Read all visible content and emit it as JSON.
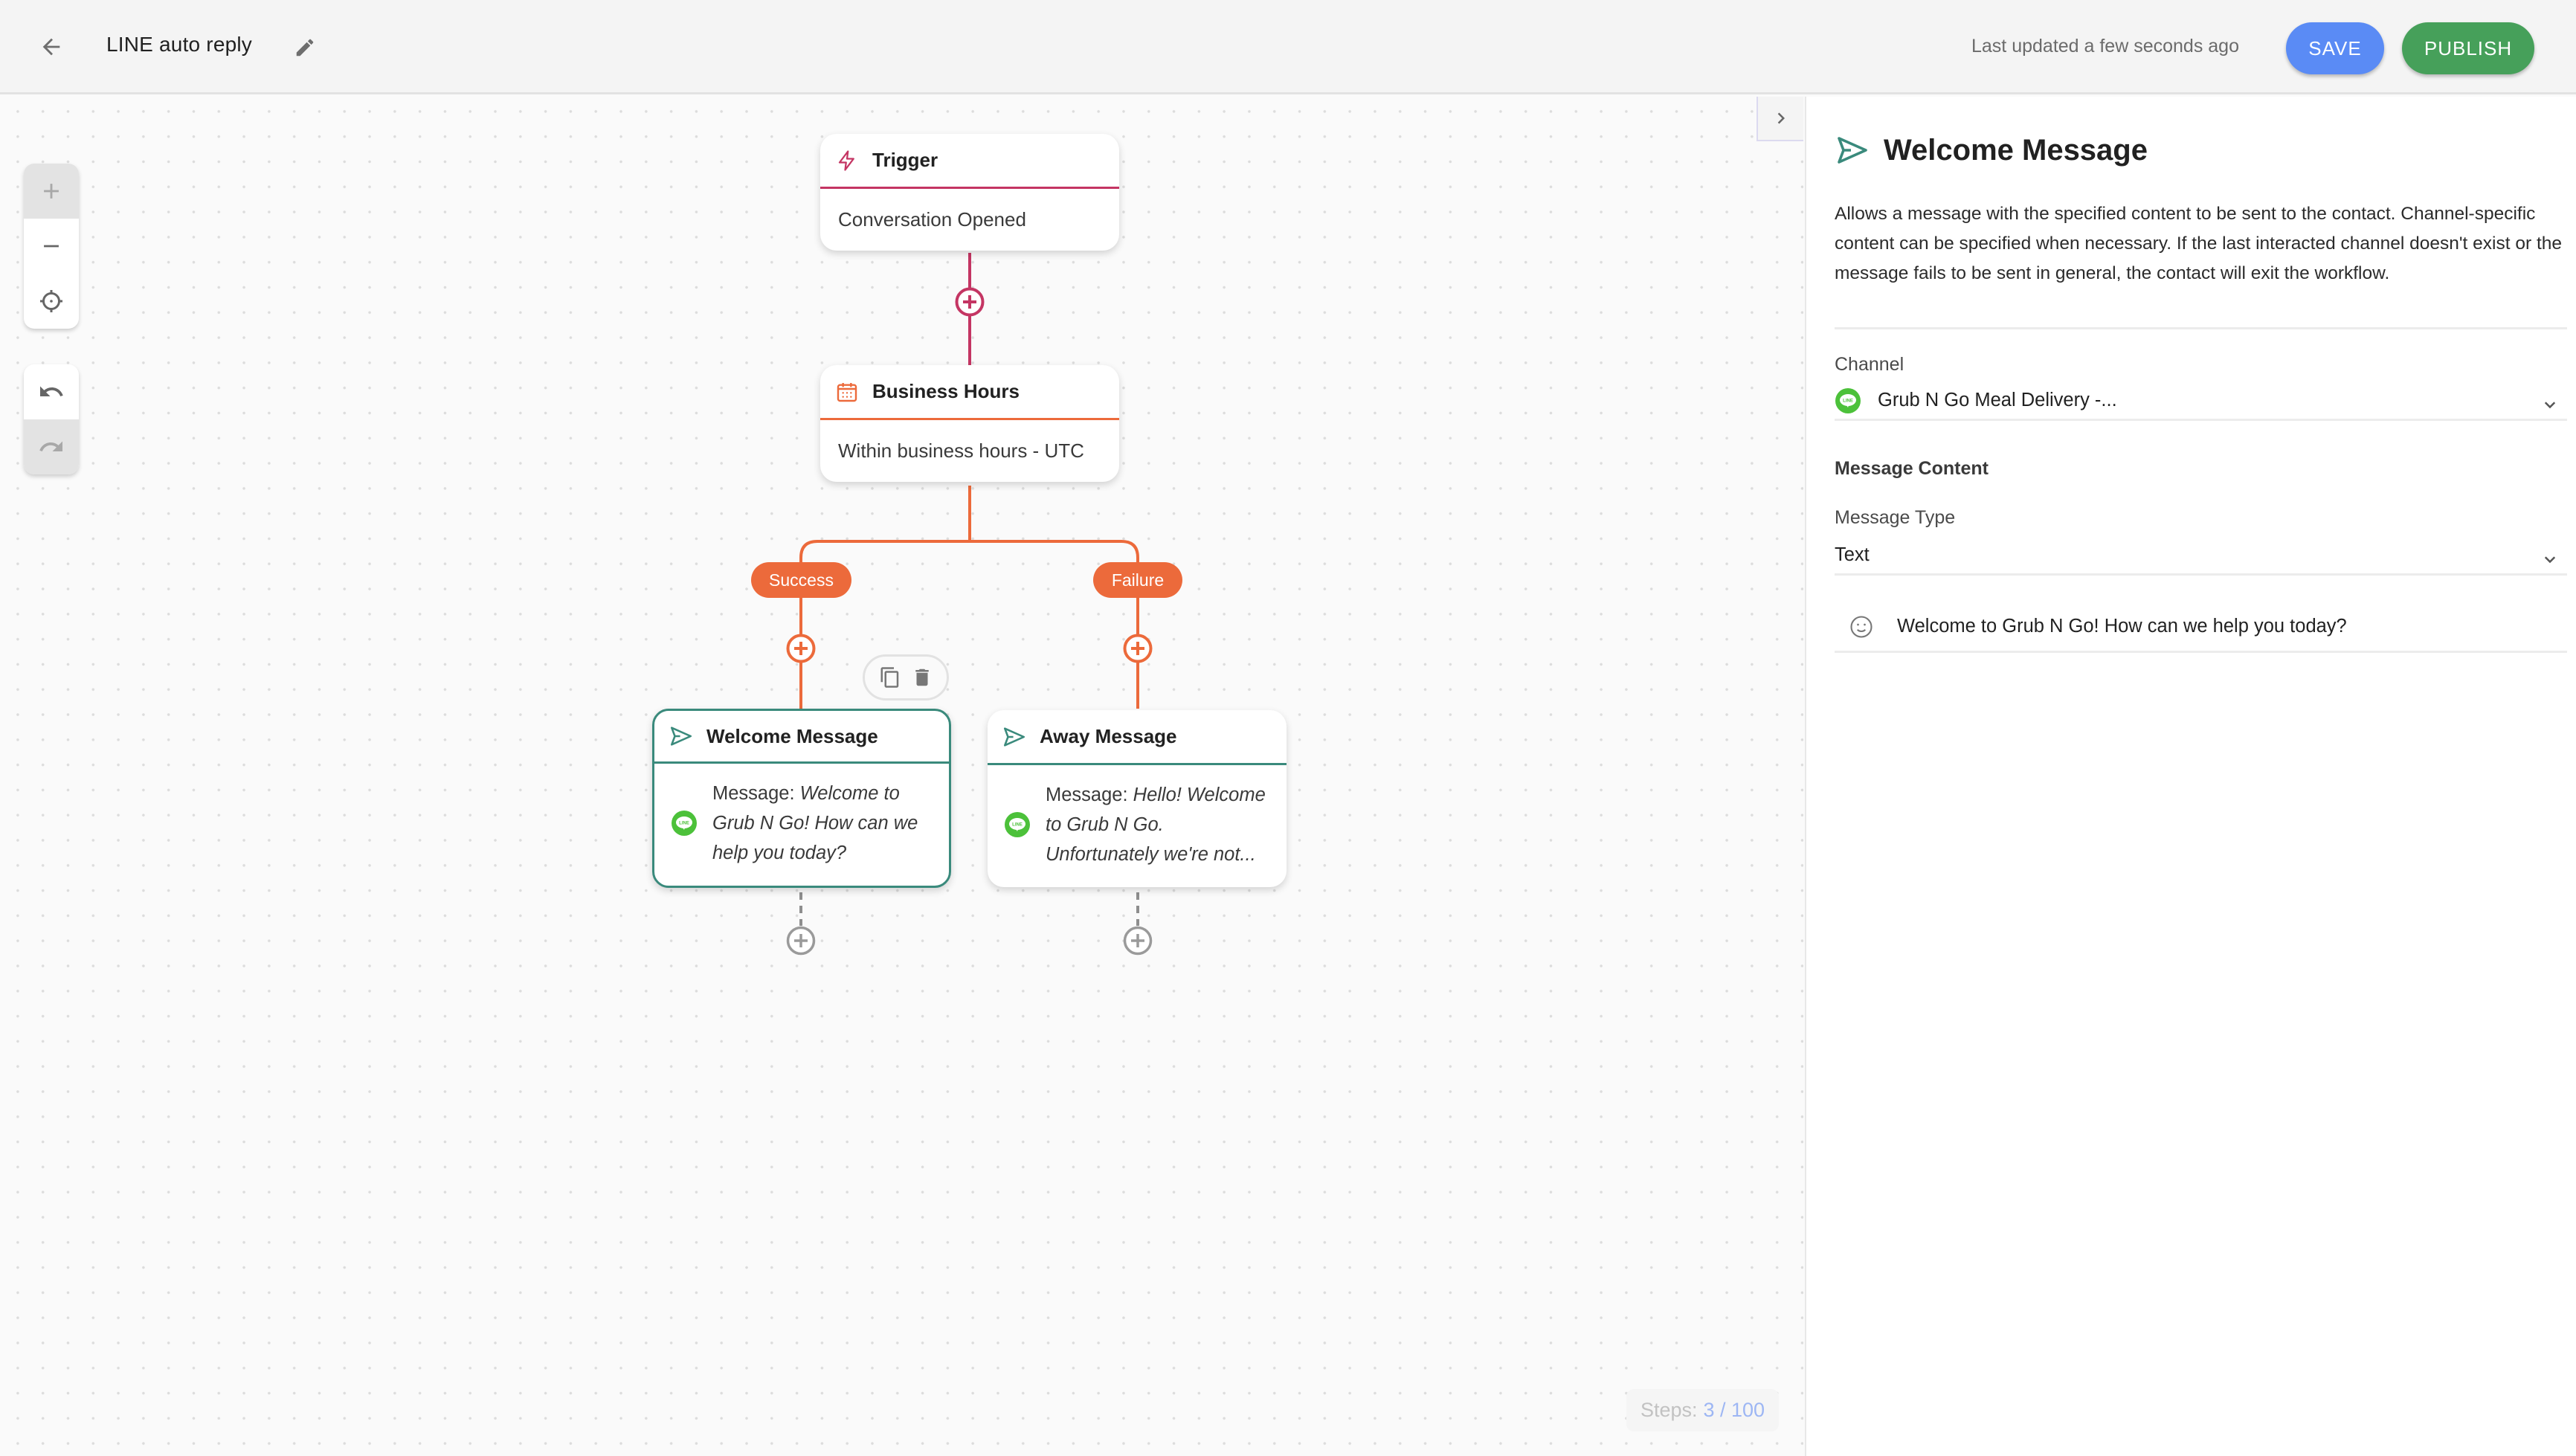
{
  "header": {
    "title": "LINE auto reply",
    "last_updated": "Last updated a few seconds ago",
    "save_label": "SAVE",
    "publish_label": "PUBLISH"
  },
  "colors": {
    "trigger": "#c43563",
    "branch": "#ec6a3b",
    "message": "#3a8a7c",
    "save": "#5a8bf5",
    "publish": "#46a05a",
    "line_green": "#4cc13a"
  },
  "canvas": {
    "controls": {
      "zoom_in": {
        "icon": "plus-icon",
        "disabled": true
      },
      "zoom_out": {
        "icon": "minus-icon",
        "disabled": false
      },
      "recenter": {
        "icon": "crosshair-icon",
        "disabled": false
      },
      "undo": {
        "icon": "undo-icon",
        "disabled": false
      },
      "redo": {
        "icon": "redo-icon",
        "disabled": true
      }
    },
    "nodes": {
      "trigger": {
        "title": "Trigger",
        "icon": "lightning-icon",
        "body": "Conversation Opened"
      },
      "business_hours": {
        "title": "Business Hours",
        "icon": "calendar-icon",
        "body": "Within business hours - UTC"
      },
      "welcome": {
        "title": "Welcome Message",
        "icon": "send-icon",
        "label": "Message:",
        "message": "Welcome to Grub N Go! How can we help  you today?",
        "channel_icon": "line-icon",
        "selected": true
      },
      "away": {
        "title": "Away Message",
        "icon": "send-icon",
        "label": "Message:",
        "message": "Hello! Welcome to Grub N Go. Unfortunately we're not...",
        "channel_icon": "line-icon",
        "selected": false
      }
    },
    "branches": {
      "success": "Success",
      "failure": "Failure"
    },
    "node_actions": [
      "copy-icon",
      "delete-icon"
    ],
    "steps": {
      "label": "Steps:",
      "value": "3 / 100",
      "used": 3,
      "max": 100
    }
  },
  "panel": {
    "title": "Welcome Message",
    "description": "Allows a message with the specified content to be sent to the contact. Channel-specific content can be specified when necessary. If the last interacted channel doesn't exist or the message fails to be sent in general, the contact will exit the workflow.",
    "channel_label": "Channel",
    "channel_value": "Grub N Go Meal Delivery -...",
    "message_content_label": "Message Content",
    "message_type_label": "Message Type",
    "message_type_value": "Text",
    "message_text": "Welcome to Grub N Go! How can we help you today?"
  }
}
